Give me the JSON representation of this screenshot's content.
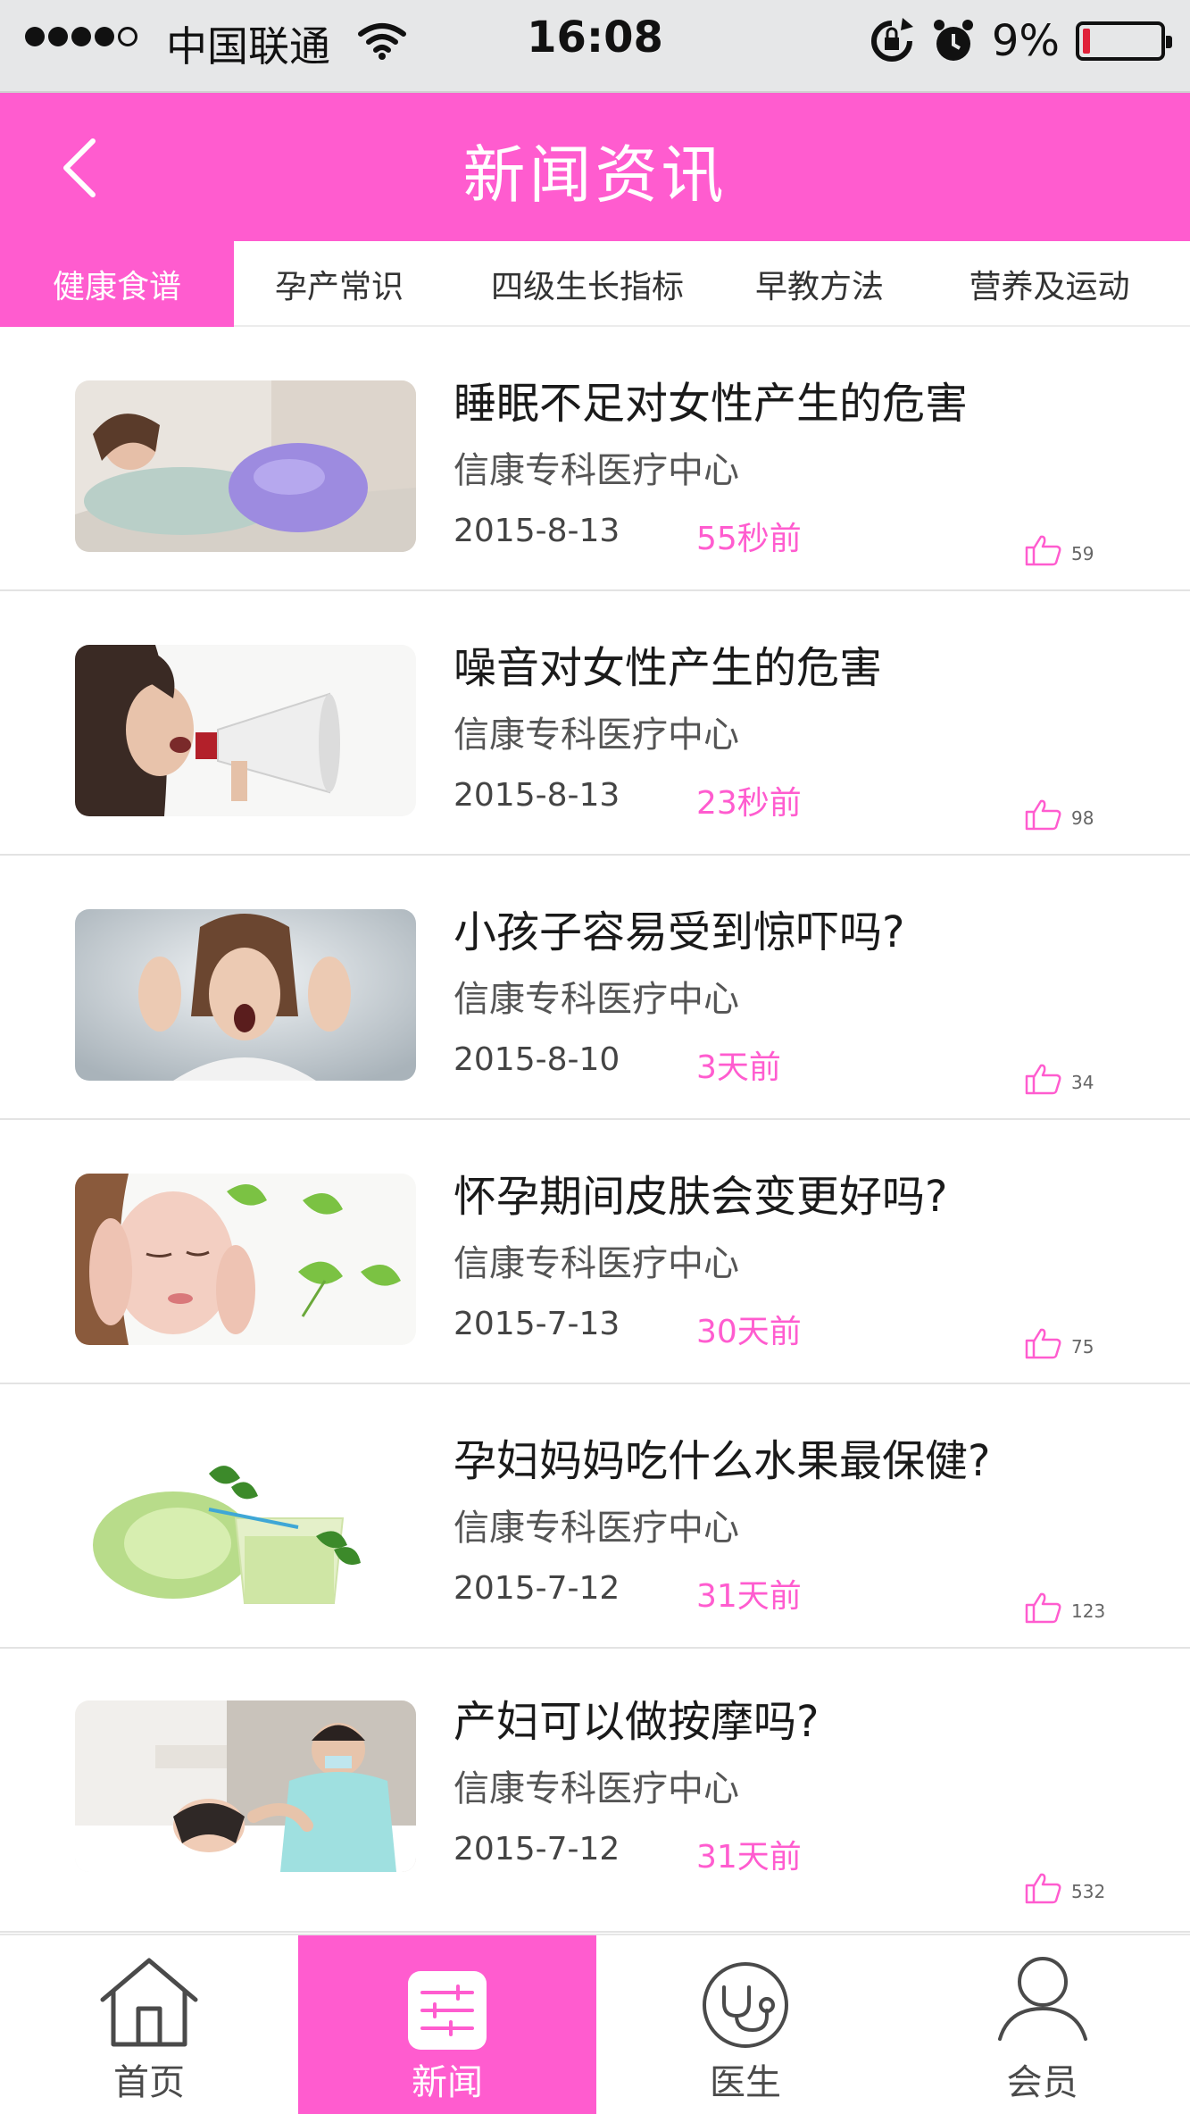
{
  "status_bar": {
    "carrier": "中国联通",
    "time": "16:08",
    "battery": "9%",
    "battery_level": 0.09,
    "battery_color": "#e0223a"
  },
  "header": {
    "title": "新闻资讯",
    "back_icon": "chevron-left-icon"
  },
  "tabs": [
    {
      "label": "健康食谱",
      "active": true
    },
    {
      "label": "孕产常识",
      "active": false
    },
    {
      "label": "四级生长指标",
      "active": false
    },
    {
      "label": "早教方法",
      "active": false
    },
    {
      "label": "营养及运动",
      "active": false
    }
  ],
  "articles": [
    {
      "title": "睡眠不足对女性产生的危害",
      "source": "信康专科医疗中心",
      "date": "2015-8-13",
      "ago": "55秒前",
      "likes": "59"
    },
    {
      "title": "噪音对女性产生的危害",
      "source": "信康专科医疗中心",
      "date": "2015-8-13",
      "ago": "23秒前",
      "likes": "98"
    },
    {
      "title": "小孩子容易受到惊吓吗?",
      "source": "信康专科医疗中心",
      "date": "2015-8-10",
      "ago": "3天前",
      "likes": "34"
    },
    {
      "title": "怀孕期间皮肤会变更好吗?",
      "source": "信康专科医疗中心",
      "date": "2015-7-13",
      "ago": "30天前",
      "likes": "75"
    },
    {
      "title": "孕妇妈妈吃什么水果最保健?",
      "source": "信康专科医疗中心",
      "date": "2015-7-12",
      "ago": "31天前",
      "likes": "123"
    },
    {
      "title": "产妇可以做按摩吗?",
      "source": "信康专科医疗中心",
      "date": "2015-7-12",
      "ago": "31天前",
      "likes": "532"
    }
  ],
  "tabbar": [
    {
      "label": "首页",
      "icon": "home-icon",
      "active": false
    },
    {
      "label": "新闻",
      "icon": "news-icon",
      "active": true
    },
    {
      "label": "医生",
      "icon": "stethoscope-icon",
      "active": false
    },
    {
      "label": "会员",
      "icon": "user-icon",
      "active": false
    }
  ],
  "colors": {
    "accent": "#ff5ccf",
    "like": "#ff5ccf"
  }
}
